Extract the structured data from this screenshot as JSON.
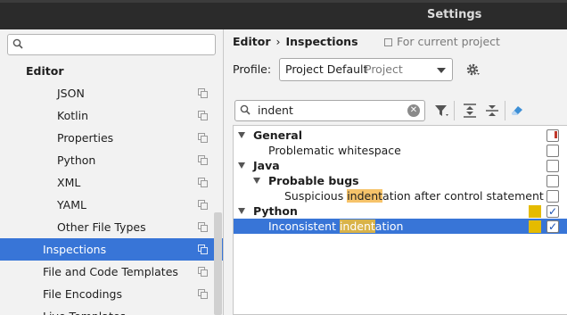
{
  "window": {
    "title": "Settings"
  },
  "sidebar": {
    "search": {
      "value": ""
    },
    "group": "Editor",
    "items": [
      {
        "label": "JSON"
      },
      {
        "label": "Kotlin"
      },
      {
        "label": "Properties"
      },
      {
        "label": "Python"
      },
      {
        "label": "XML"
      },
      {
        "label": "YAML"
      },
      {
        "label": "Other File Types"
      },
      {
        "label": "Inspections",
        "selected": true
      },
      {
        "label": "File and Code Templates"
      },
      {
        "label": "File Encodings"
      },
      {
        "label": "Live Templates"
      }
    ]
  },
  "breadcrumb": {
    "parent": "Editor",
    "separator": "›",
    "current": "Inspections",
    "scope": "For current project"
  },
  "profile": {
    "label": "Profile:",
    "name": "Project Default",
    "scope": "Project"
  },
  "filter": {
    "value": "indent"
  },
  "tree": {
    "rows": [
      {
        "text": "General",
        "bold": true,
        "expanded": true,
        "checked": false
      },
      {
        "text": "Problematic whitespace",
        "bold": false,
        "checked": false
      },
      {
        "text": "Java",
        "bold": true,
        "expanded": true,
        "checked": false
      },
      {
        "text": "Probable bugs",
        "bold": true,
        "expanded": true,
        "checked": false
      },
      {
        "pre": "Suspicious ",
        "hit": "indent",
        "post": "ation after control statement w",
        "bold": false,
        "checked": false
      },
      {
        "text": "Python",
        "bold": true,
        "expanded": true,
        "checked": true
      },
      {
        "pre": "Inconsistent ",
        "hit": "indent",
        "post": "ation",
        "bold": false,
        "checked": true,
        "selected": true
      }
    ]
  },
  "colors": {
    "selection": "#3875d7",
    "severity_warning": "#e5bb00",
    "match_highlight": "#f6c36a"
  }
}
